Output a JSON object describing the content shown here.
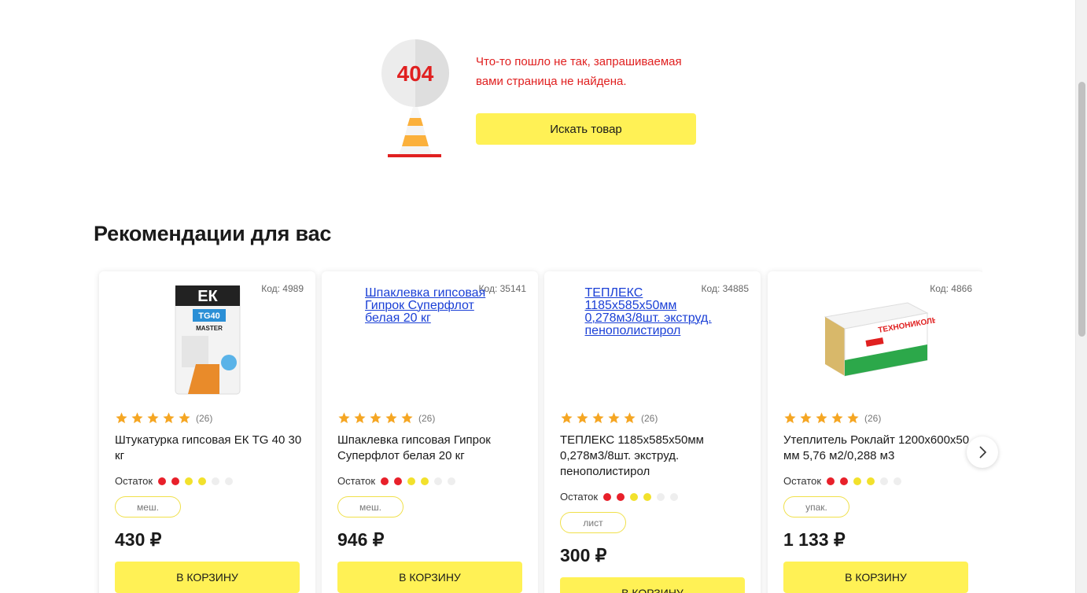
{
  "error": {
    "code": "404",
    "message": "Что-то пошло не так, запрашиваемая вами страница не найдена.",
    "search_button": "Искать товар"
  },
  "recommendations": {
    "title": "Рекомендации для вас",
    "products": [
      {
        "code": "Код: 4989",
        "image_alt": "",
        "rating_count": "(26)",
        "name": "Штукатурка гипсовая ЕК TG 40 30 кг",
        "stock_label": "Остаток",
        "unit": "меш.",
        "price": "430 ₽",
        "cart_button": "В КОРЗИНУ"
      },
      {
        "code": "Код: 35141",
        "image_alt": "Шпаклевка гипсовая Гипрок Суперфлот белая 20 кг",
        "rating_count": "(26)",
        "name": "Шпаклевка гипсовая Гипрок Суперфлот белая 20 кг",
        "stock_label": "Остаток",
        "unit": "меш.",
        "price": "946 ₽",
        "cart_button": "В КОРЗИНУ"
      },
      {
        "code": "Код: 34885",
        "image_alt": "ТЕПЛЕКС 1185x585x50мм 0,278м3/8шт. экструд. пенополистирол",
        "rating_count": "(26)",
        "name": "ТЕПЛЕКС 1185x585x50мм 0,278м3/8шт. экструд. пенополистирол",
        "stock_label": "Остаток",
        "unit": "лист",
        "price": "300 ₽",
        "cart_button": "В КОРЗИНУ"
      },
      {
        "code": "Код: 4866",
        "image_alt": "",
        "rating_count": "(26)",
        "name": "Утеплитель Роклайт 1200x600x50 мм 5,76 м2/0,288 м3",
        "stock_label": "Остаток",
        "unit": "упак.",
        "price": "1 133 ₽",
        "cart_button": "В КОРЗИНУ"
      }
    ]
  },
  "colors": {
    "accent_yellow": "#fff155",
    "error_red": "#e02020",
    "star": "#f5a623",
    "stock_red": "#e8202a",
    "stock_yellow": "#f2e12c",
    "stock_empty": "#eeeeee"
  },
  "icons": {
    "traffic_cone": "traffic-cone-404-icon",
    "star": "star-icon",
    "next": "chevron-right-icon"
  }
}
